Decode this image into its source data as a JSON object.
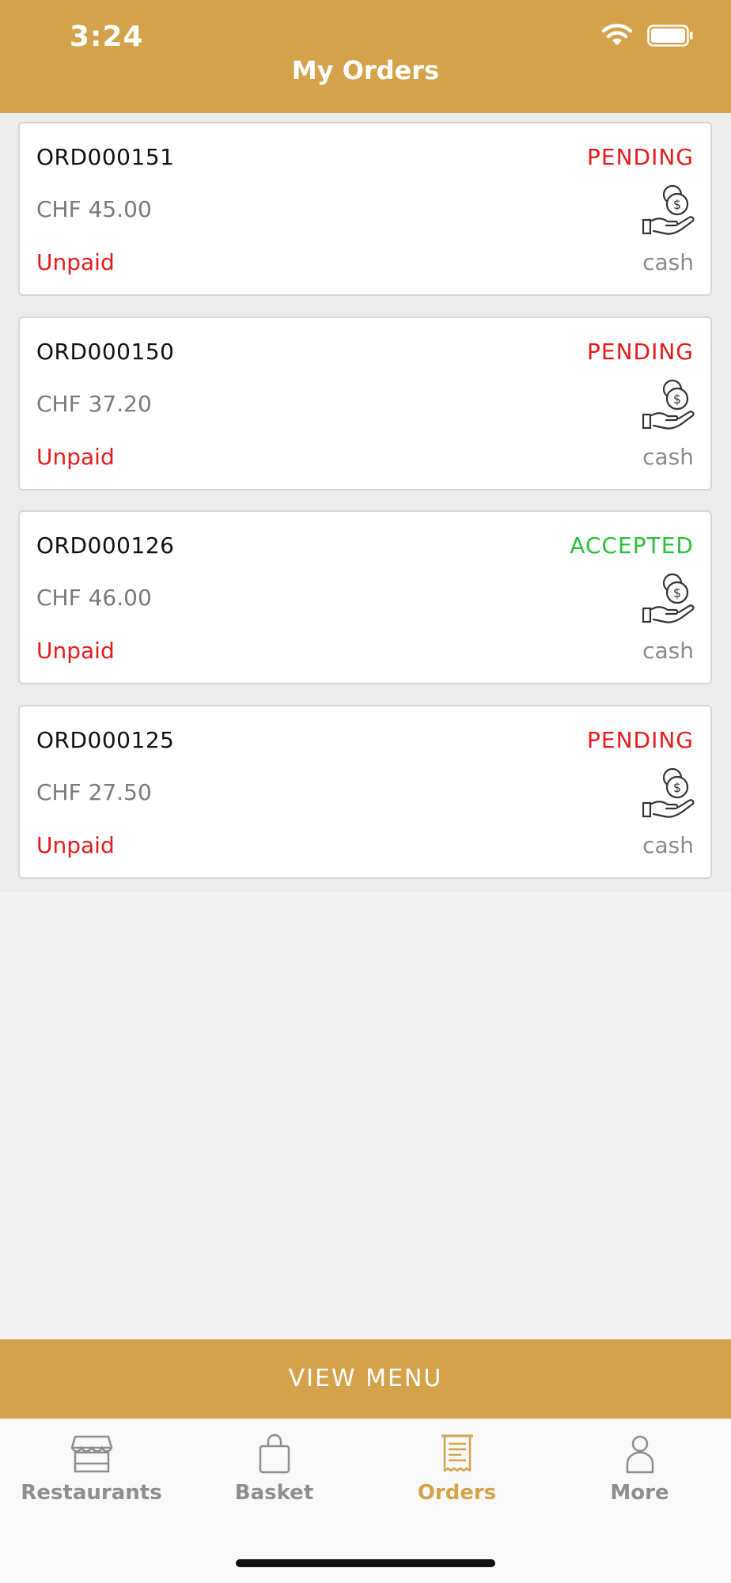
{
  "status_bar": {
    "time": "3:24",
    "icons": [
      "wifi-icon",
      "battery-icon"
    ]
  },
  "header": {
    "title": "My Orders"
  },
  "orders": [
    {
      "id": "ORD000151",
      "status": "PENDING",
      "status_color": "#e31b1b",
      "amount": "CHF 45.00",
      "payment_status": "Unpaid",
      "payment_method": "cash",
      "payment_icon": "cash-in-hand-icon"
    },
    {
      "id": "ORD000150",
      "status": "PENDING",
      "status_color": "#e31b1b",
      "amount": "CHF 37.20",
      "payment_status": "Unpaid",
      "payment_method": "cash",
      "payment_icon": "cash-in-hand-icon"
    },
    {
      "id": "ORD000126",
      "status": "ACCEPTED",
      "status_color": "#2cc03c",
      "amount": "CHF 46.00",
      "payment_status": "Unpaid",
      "payment_method": "cash",
      "payment_icon": "cash-in-hand-icon"
    },
    {
      "id": "ORD000125",
      "status": "PENDING",
      "status_color": "#e31b1b",
      "amount": "CHF 27.50",
      "payment_status": "Unpaid",
      "payment_method": "cash",
      "payment_icon": "cash-in-hand-icon"
    }
  ],
  "view_menu_button": {
    "label": "VIEW MENU"
  },
  "tab_bar": {
    "active": "Orders",
    "tabs": [
      {
        "label": "Restaurants",
        "icon": "storefront-icon"
      },
      {
        "label": "Basket",
        "icon": "shopping-bag-icon"
      },
      {
        "label": "Orders",
        "icon": "receipt-icon"
      },
      {
        "label": "More",
        "icon": "person-icon"
      }
    ]
  },
  "colors": {
    "brand": "#d4a24a",
    "pending": "#e31b1b",
    "accepted": "#2cc03c",
    "unpaid": "#e31b1b",
    "tab_inactive": "#8e8e8e"
  }
}
